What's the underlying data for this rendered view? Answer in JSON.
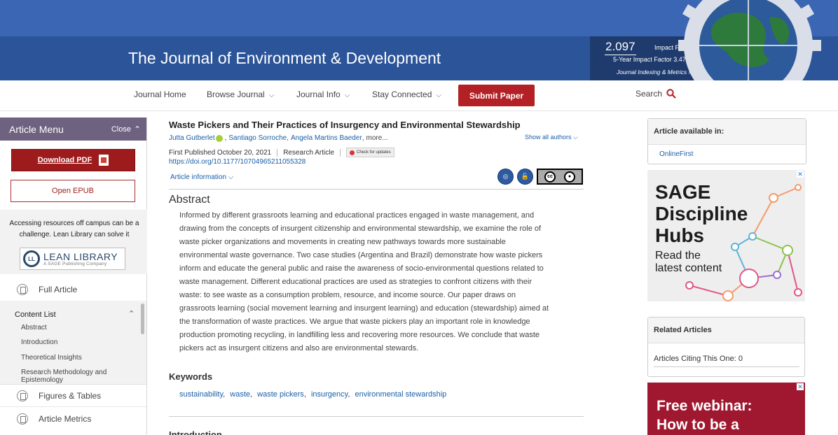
{
  "header": {
    "journal_title": "The Journal of Environment & Development",
    "impact_factor": "2.097",
    "impact_factor_label": "Impact Factor",
    "five_year_label": "5-Year Impact Factor 3.475",
    "indexing_link": "Journal Indexing & Metrics »"
  },
  "nav": {
    "home": "Journal Home",
    "browse": "Browse Journal",
    "info": "Journal Info",
    "stay": "Stay Connected",
    "submit": "Submit Paper",
    "search": "Search"
  },
  "sidebar": {
    "menu_title": "Article Menu",
    "close": "Close",
    "download_pdf": "Download PDF",
    "open_epub": "Open EPUB",
    "lean_text": "Accessing resources off campus can be a challenge. Lean Library can solve it",
    "lean_name": "LEAN LIBRARY",
    "lean_sub": "A SAGE Publishing Company",
    "lean_mark": "LL",
    "full_article": "Full Article",
    "content_list": "Content List",
    "toc": [
      "Abstract",
      "Introduction",
      "Theoretical Insights",
      "Research Methodology and Epistemology"
    ],
    "figures_tables": "Figures & Tables",
    "article_metrics": "Article Metrics"
  },
  "article": {
    "title": "Waste Pickers and Their Practices of Insurgency and Environmental Stewardship",
    "authors": [
      "Jutta Gutberlet",
      "Santiago Sorroche",
      "Angela Martins Baeder"
    ],
    "more": "more...",
    "show_all_authors": "Show all authors",
    "first_published": "First Published October 20, 2021",
    "article_type": "Research Article",
    "check_updates": "Check for updates",
    "doi": "https://doi.org/10.1177/10704965211055328",
    "article_information": "Article information",
    "abstract_heading": "Abstract",
    "abstract_lines": [
      "Informed by different grassroots learning and educational practices engaged in waste management, and",
      "drawing from the concepts of insurgent citizenship and environmental stewardship, we examine the role of",
      "waste picker organizations and movements in creating new pathways towards more sustainable",
      "environmental waste governance. Two case studies (Argentina and Brazil) demonstrate how waste pickers",
      "inform and educate the general public and raise the awareness of socio-environmental questions related to",
      "waste management. Different educational practices are used as strategies to confront citizens with their",
      "waste: to see waste as a consumption problem, resource, and income source. Our paper draws on",
      "grassroots learning (social movement learning and insurgent learning) and education (stewardship) aimed at",
      "the transformation of waste practices. We argue that waste pickers play an important role in knowledge",
      "production promoting recycling, in landfilling less and recovering more resources. We conclude that waste",
      "pickers act as insurgent citizens and also are environmental stewards."
    ],
    "keywords_heading": "Keywords",
    "keywords": [
      "sustainability",
      "waste",
      "waste pickers",
      "insurgency",
      "environmental stewardship"
    ],
    "next_section": "Introduction"
  },
  "right": {
    "available_title": "Article available in:",
    "onlinefirst": "OnlineFirst",
    "ad_hubs_title": [
      "SAGE",
      "Discipline",
      "Hubs"
    ],
    "ad_hubs_sub": [
      "Read the",
      "latest content"
    ],
    "related_title": "Related Articles",
    "citing": "Articles Citing This One: 0",
    "ad_webinar": [
      "Free webinar:",
      "How to be a"
    ]
  },
  "colors": {
    "header_blue": "#3a66b4",
    "title_band": "#2c5499",
    "submit_red": "#b32126",
    "menu_purple": "#6e6280",
    "link_blue": "#1a5fa8"
  }
}
